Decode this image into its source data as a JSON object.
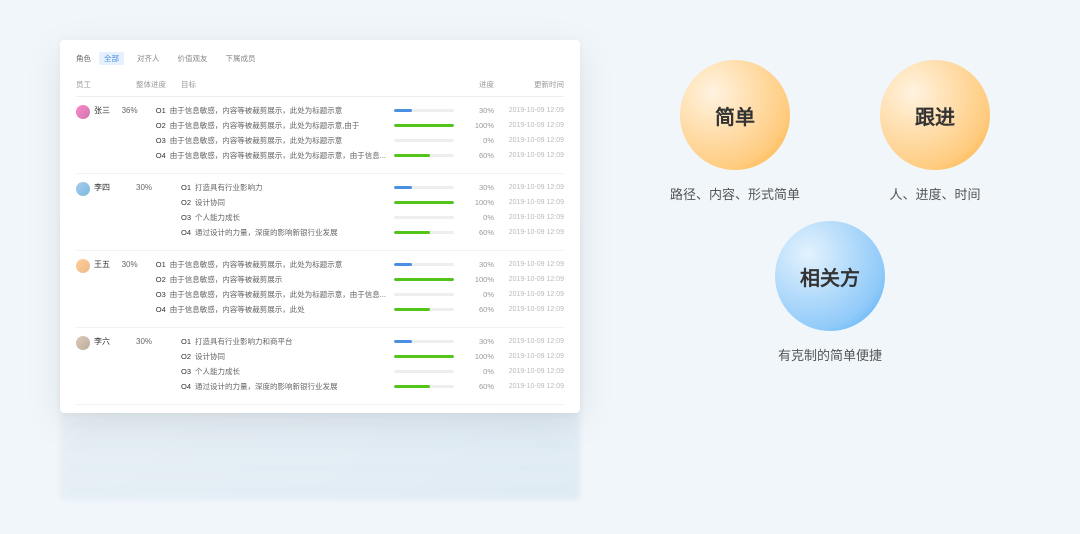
{
  "filter": {
    "label": "角色",
    "opts": [
      "全部",
      "对齐人",
      "价值观友",
      "下属成员"
    ]
  },
  "thead": {
    "emp": "员工",
    "prog": "整体进度",
    "obj": "目标",
    "pct": "进度",
    "date": "更新时间"
  },
  "employees": [
    {
      "name": "张三",
      "avatar": "a",
      "progress": "36%",
      "objs": [
        {
          "code": "O1",
          "text": "由于信息敏感，内容等被裁剪展示，此处为标题示意",
          "pct": 30,
          "color": "blue",
          "date": "2019-10-09 12:09"
        },
        {
          "code": "O2",
          "text": "由于信息敏感，内容等被裁剪展示，此处为标题示意,由于",
          "pct": 100,
          "color": "green",
          "date": "2019-10-09 12:09"
        },
        {
          "code": "O3",
          "text": "由于信息敏感，内容等被裁剪展示，此处为标题示意",
          "pct": 0,
          "color": "blue",
          "date": "2019-10-09 12:09"
        },
        {
          "code": "O4",
          "text": "由于信息敏感，内容等被裁剪展示，此处为标题示意，由于信息...",
          "pct": 60,
          "color": "green",
          "date": "2019-10-09 12:09"
        }
      ]
    },
    {
      "name": "李四",
      "avatar": "b",
      "progress": "30%",
      "objs": [
        {
          "code": "O1",
          "text": "打造具有行业影响力",
          "pct": 30,
          "color": "blue",
          "date": "2019-10-09 12:09"
        },
        {
          "code": "O2",
          "text": "设计协同",
          "pct": 100,
          "color": "green",
          "date": "2019-10-09 12:09"
        },
        {
          "code": "O3",
          "text": "个人能力成长",
          "pct": 0,
          "color": "blue",
          "date": "2019-10-09 12:09"
        },
        {
          "code": "O4",
          "text": "通过设计的力量，深度的影响新银行业发展",
          "pct": 60,
          "color": "green",
          "date": "2019-10-09 12:09"
        }
      ]
    },
    {
      "name": "王五",
      "avatar": "c",
      "progress": "30%",
      "objs": [
        {
          "code": "O1",
          "text": "由于信息敏感，内容等被裁剪展示，此处为标题示意",
          "pct": 30,
          "color": "blue",
          "date": "2019-10-09 12:09"
        },
        {
          "code": "O2",
          "text": "由于信息敏感，内容等被裁剪展示",
          "pct": 100,
          "color": "green",
          "date": "2019-10-09 12:09"
        },
        {
          "code": "O3",
          "text": "由于信息敏感，内容等被裁剪展示，此处为标题示意，由于信息...",
          "pct": 0,
          "color": "blue",
          "date": "2019-10-09 12:09"
        },
        {
          "code": "O4",
          "text": "由于信息敏感，内容等被裁剪展示，此处",
          "pct": 60,
          "color": "green",
          "date": "2019-10-09 12:09"
        }
      ]
    },
    {
      "name": "李六",
      "avatar": "d",
      "progress": "30%",
      "objs": [
        {
          "code": "O1",
          "text": "打造具有行业影响力和商平台",
          "pct": 30,
          "color": "blue",
          "date": "2019-10-09 12:09"
        },
        {
          "code": "O2",
          "text": "设计协同",
          "pct": 100,
          "color": "green",
          "date": "2019-10-09 12:09"
        },
        {
          "code": "O3",
          "text": "个人能力成长",
          "pct": 0,
          "color": "blue",
          "date": "2019-10-09 12:09"
        },
        {
          "code": "O4",
          "text": "通过设计的力量，深度的影响新银行业发展",
          "pct": 60,
          "color": "green",
          "date": "2019-10-09 12:09"
        }
      ]
    }
  ],
  "circles": {
    "c1": {
      "title": "简单",
      "caption": "路径、内容、形式简单"
    },
    "c2": {
      "title": "跟进",
      "caption": "人、进度、时间"
    },
    "c3": {
      "title": "相关方",
      "caption": "有克制的简单便捷"
    }
  }
}
